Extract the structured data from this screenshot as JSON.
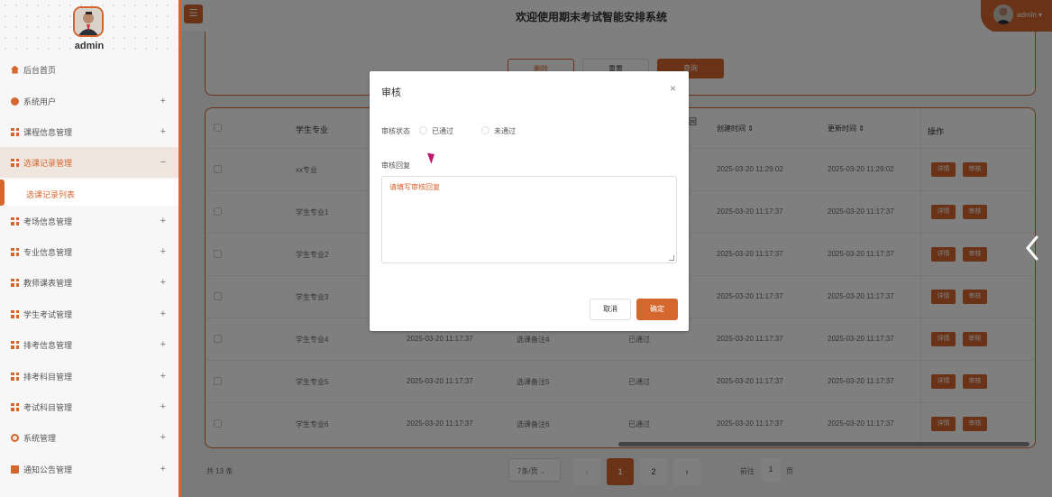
{
  "user": {
    "name": "admin",
    "top_name": "admin"
  },
  "sidebar": {
    "items": [
      {
        "label": "后台首页",
        "icon": "house-icon",
        "toggle": ""
      },
      {
        "label": "系统用户",
        "icon": "user-icon",
        "toggle": "+"
      },
      {
        "label": "课程信息管理",
        "icon": "grid-icon",
        "toggle": "+"
      },
      {
        "label": "选课记录管理",
        "icon": "grid-icon",
        "toggle": "−"
      },
      {
        "label": "考场信息管理",
        "icon": "grid-icon",
        "toggle": "+"
      },
      {
        "label": "专业信息管理",
        "icon": "grid-icon",
        "toggle": "+"
      },
      {
        "label": "教师课表管理",
        "icon": "grid-icon",
        "toggle": "+"
      },
      {
        "label": "学生考试管理",
        "icon": "grid-icon",
        "toggle": "+"
      },
      {
        "label": "排考信息管理",
        "icon": "grid-icon",
        "toggle": "+"
      },
      {
        "label": "排考科目管理",
        "icon": "grid-icon",
        "toggle": "+"
      },
      {
        "label": "考试科目管理",
        "icon": "grid-icon",
        "toggle": "+"
      },
      {
        "label": "系统管理",
        "icon": "gear-icon",
        "toggle": "+"
      },
      {
        "label": "通知公告管理",
        "icon": "doc-icon",
        "toggle": "+"
      }
    ],
    "sub_item": "选课记录列表"
  },
  "header": {
    "menu_icon": "☰",
    "title": "欢迎使用期末考试智能安排系统"
  },
  "search": {
    "delete_label": "删除",
    "reset_label": "重置",
    "query_label": "查询"
  },
  "table": {
    "columns": [
      "学生专业",
      "",
      "",
      "",
      "创建时间 ⇕",
      "更新时间 ⇕",
      "操作"
    ],
    "column_fragment": "回",
    "rows": [
      {
        "major": "xx专业",
        "time": "",
        "note": "",
        "status": "",
        "created": "2025-03-20 11:29:02",
        "updated": "2025-03-20 11:29:02"
      },
      {
        "major": "学生专业1",
        "time": "",
        "note": "",
        "status": "",
        "created": "2025-03-20 11:17:37",
        "updated": "2025-03-20 11:17:37"
      },
      {
        "major": "学生专业2",
        "time": "",
        "note": "",
        "status": "",
        "created": "2025-03-20 11:17:37",
        "updated": "2025-03-20 11:17:37"
      },
      {
        "major": "学生专业3",
        "time": "",
        "note": "",
        "status": "",
        "created": "2025-03-20 11:17:37",
        "updated": "2025-03-20 11:17:37"
      },
      {
        "major": "学生专业4",
        "time": "2025-03-20 11:17:37",
        "note": "选课备注4",
        "status": "已通过",
        "created": "2025-03-20 11:17:37",
        "updated": "2025-03-20 11:17:37"
      },
      {
        "major": "学生专业5",
        "time": "2025-03-20 11:17:37",
        "note": "选课备注5",
        "status": "已通过",
        "created": "2025-03-20 11:17:37",
        "updated": "2025-03-20 11:17:37"
      },
      {
        "major": "学生专业6",
        "time": "2025-03-20 11:17:37",
        "note": "选课备注6",
        "status": "已通过",
        "created": "2025-03-20 11:17:37",
        "updated": "2025-03-20 11:17:37"
      }
    ],
    "detail_label": "详情",
    "audit_label": "审核"
  },
  "pager": {
    "total": "共 13 条",
    "page_size": "7条/页",
    "prev": "‹",
    "next": "›",
    "pages": [
      "1",
      "2"
    ],
    "goto_prefix": "前往",
    "goto_value": "1",
    "goto_suffix": "页"
  },
  "dialog": {
    "title": "审核",
    "close": "×",
    "status_label": "审核状态",
    "options": [
      "已通过",
      "未通过"
    ],
    "reply_label": "审核回复",
    "reply_placeholder": "请填写审核回复",
    "cancel_label": "取消",
    "ok_label": "确定"
  },
  "colors": {
    "accent": "#d4662e"
  }
}
